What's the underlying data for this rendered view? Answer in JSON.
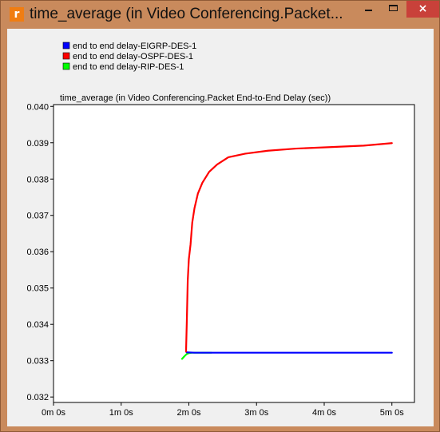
{
  "window": {
    "app_icon": "r",
    "title": "time_average (in Video Conferencing.Packet...",
    "close_glyph": "×"
  },
  "chart_data": {
    "type": "line",
    "title": "time_average (in Video Conferencing.Packet End-to-End Delay (sec))",
    "xlabel": "",
    "ylabel": "",
    "x_unit": "seconds",
    "xlim": [
      0,
      320
    ],
    "ylim": [
      0.03185,
      0.04005
    ],
    "x_ticks": [
      0,
      60,
      120,
      180,
      240,
      300
    ],
    "x_tick_labels": [
      "0m 0s",
      "1m 0s",
      "2m 0s",
      "3m 0s",
      "4m 0s",
      "5m 0s"
    ],
    "y_ticks": [
      0.032,
      0.033,
      0.034,
      0.035,
      0.036,
      0.037,
      0.038,
      0.039,
      0.04
    ],
    "y_tick_labels": [
      "0.032",
      "0.033",
      "0.034",
      "0.035",
      "0.036",
      "0.037",
      "0.038",
      "0.039",
      "0.040"
    ],
    "grid": false,
    "legend_position": "top-left",
    "series": [
      {
        "name": "end to end delay-EIGRP-DES-1",
        "color": "#0000ff",
        "x": [
          118,
          125,
          150,
          200,
          250,
          300
        ],
        "y": [
          0.03323,
          0.03322,
          0.03322,
          0.03322,
          0.03322,
          0.03322
        ]
      },
      {
        "name": "end to end delay-OSPF-DES-1",
        "color": "#ff0000",
        "x": [
          117.5,
          118.2,
          119,
          120,
          121.5,
          123,
          125,
          128,
          132,
          138,
          145,
          155,
          170,
          190,
          215,
          245,
          275,
          300
        ],
        "y": [
          0.03325,
          0.0341,
          0.0352,
          0.0358,
          0.0362,
          0.0368,
          0.0372,
          0.0376,
          0.0379,
          0.0382,
          0.0384,
          0.0386,
          0.0387,
          0.03878,
          0.03884,
          0.03888,
          0.03892,
          0.03899
        ]
      },
      {
        "name": "end to end delay-RIP-DES-1",
        "color": "#00ff00",
        "x": [
          114,
          116,
          118,
          120,
          123,
          127,
          132,
          140
        ],
        "y": [
          0.03305,
          0.03312,
          0.03318,
          0.03321,
          0.03322,
          0.03322,
          0.03322,
          0.03322
        ]
      }
    ]
  }
}
